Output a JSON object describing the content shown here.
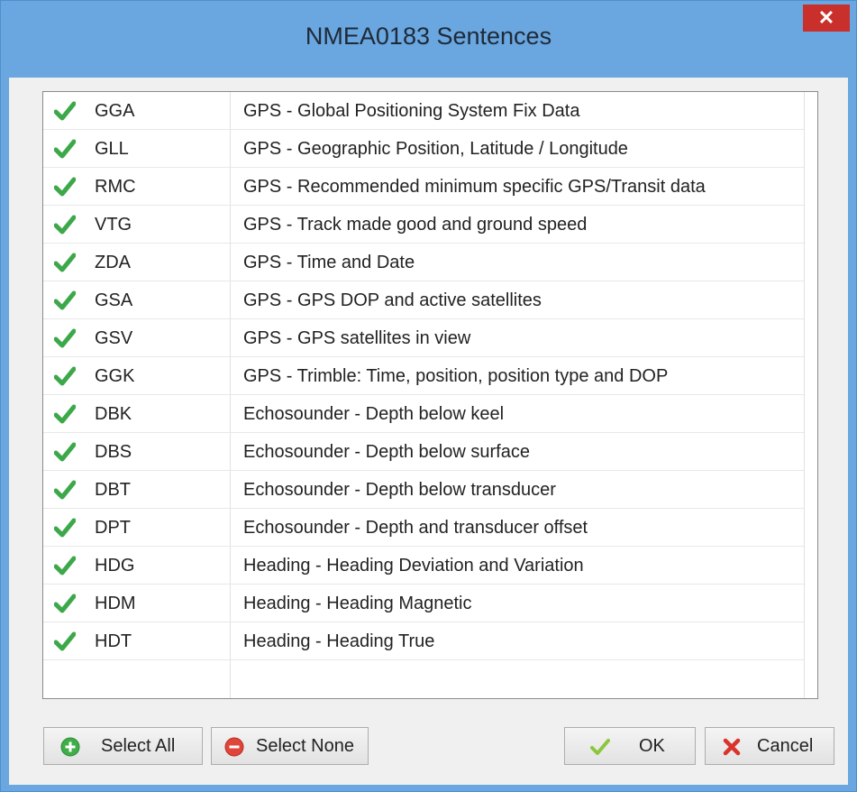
{
  "window": {
    "title": "NMEA0183 Sentences",
    "close_glyph": "✕"
  },
  "sentences": [
    {
      "code": "GGA",
      "description": "GPS - Global Positioning System Fix Data",
      "checked": true
    },
    {
      "code": "GLL",
      "description": "GPS - Geographic Position, Latitude / Longitude",
      "checked": true
    },
    {
      "code": "RMC",
      "description": "GPS - Recommended minimum specific GPS/Transit data",
      "checked": true
    },
    {
      "code": "VTG",
      "description": "GPS - Track made good and ground speed",
      "checked": true
    },
    {
      "code": "ZDA",
      "description": "GPS - Time and Date",
      "checked": true
    },
    {
      "code": "GSA",
      "description": "GPS - GPS DOP and active satellites",
      "checked": true
    },
    {
      "code": "GSV",
      "description": "GPS - GPS satellites in view",
      "checked": true
    },
    {
      "code": "GGK",
      "description": "GPS - Trimble: Time, position, position type and DOP",
      "checked": true
    },
    {
      "code": "DBK",
      "description": "Echosounder - Depth below keel",
      "checked": true
    },
    {
      "code": "DBS",
      "description": "Echosounder - Depth below surface",
      "checked": true
    },
    {
      "code": "DBT",
      "description": "Echosounder - Depth below transducer",
      "checked": true
    },
    {
      "code": "DPT",
      "description": "Echosounder - Depth and transducer offset",
      "checked": true
    },
    {
      "code": "HDG",
      "description": "Heading - Heading Deviation and Variation",
      "checked": true
    },
    {
      "code": "HDM",
      "description": "Heading - Heading Magnetic",
      "checked": true
    },
    {
      "code": "HDT",
      "description": "Heading - Heading True",
      "checked": true
    }
  ],
  "buttons": {
    "select_all": "Select All",
    "select_none": "Select None",
    "ok": "OK",
    "cancel": "Cancel"
  },
  "icons": {
    "row_check": "green-checkmark-icon",
    "select_all": "plus-circle-icon",
    "select_none": "minus-circle-icon",
    "ok": "checkmark-icon",
    "cancel": "red-x-icon",
    "close": "close-icon"
  },
  "colors": {
    "title_bar": "#6aa6df",
    "close_button": "#c9302c",
    "check_green": "#3da84a",
    "select_all_green": "#3fae49",
    "select_none_red": "#e0453a",
    "cancel_red": "#d9332b"
  }
}
